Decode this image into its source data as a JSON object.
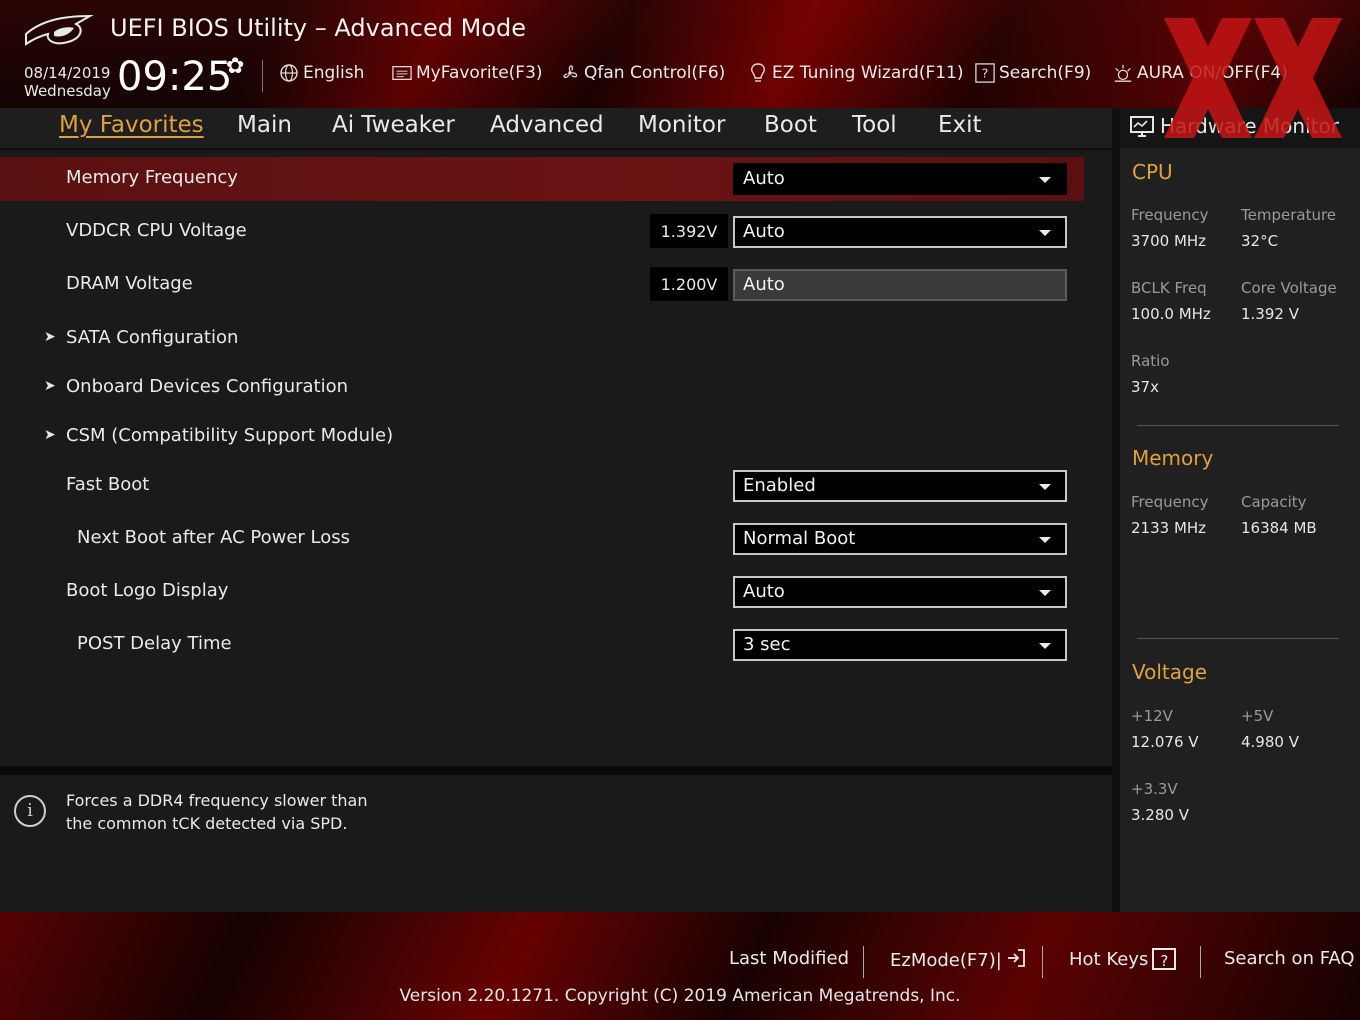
{
  "header": {
    "title": "UEFI BIOS Utility – Advanced Mode",
    "date": "08/14/2019",
    "weekday": "Wednesday",
    "time": "09:25",
    "tools": {
      "language": "English",
      "my_favorite": "MyFavorite(F3)",
      "qfan": "Qfan Control(F6)",
      "ez_tuning": "EZ Tuning Wizard(F11)",
      "search": "Search(F9)",
      "aura": "AURA ON/OFF(F4)"
    }
  },
  "tabs": [
    {
      "label": "My Favorites",
      "active": true
    },
    {
      "label": "Main"
    },
    {
      "label": "Ai Tweaker"
    },
    {
      "label": "Advanced"
    },
    {
      "label": "Monitor"
    },
    {
      "label": "Boot"
    },
    {
      "label": "Tool"
    },
    {
      "label": "Exit"
    }
  ],
  "settings": {
    "memory_frequency": {
      "label": "Memory Frequency",
      "value": "Auto"
    },
    "vddcr_cpu_voltage": {
      "label": "VDDCR CPU Voltage",
      "reading": "1.392V",
      "value": "Auto"
    },
    "dram_voltage": {
      "label": "DRAM Voltage",
      "reading": "1.200V",
      "value": "Auto"
    },
    "sata_config": {
      "label": "SATA Configuration"
    },
    "onboard_devices": {
      "label": "Onboard Devices Configuration"
    },
    "csm": {
      "label": "CSM (Compatibility Support Module)"
    },
    "fast_boot": {
      "label": "Fast Boot",
      "value": "Enabled"
    },
    "next_boot_ac": {
      "label": "Next Boot after AC Power Loss",
      "value": "Normal Boot"
    },
    "boot_logo": {
      "label": "Boot Logo Display",
      "value": "Auto"
    },
    "post_delay": {
      "label": "POST Delay Time",
      "value": "3 sec"
    }
  },
  "help": {
    "line1": "Forces a DDR4 frequency slower than",
    "line2": "the common tCK detected via SPD."
  },
  "hardware_monitor": {
    "title": "Hardware Monitor",
    "cpu": {
      "heading": "CPU",
      "frequency_label": "Frequency",
      "frequency": "3700 MHz",
      "temperature_label": "Temperature",
      "temperature": "32°C",
      "bclk_label": "BCLK Freq",
      "bclk": "100.0 MHz",
      "core_voltage_label": "Core Voltage",
      "core_voltage": "1.392 V",
      "ratio_label": "Ratio",
      "ratio": "37x"
    },
    "memory": {
      "heading": "Memory",
      "frequency_label": "Frequency",
      "frequency": "2133 MHz",
      "capacity_label": "Capacity",
      "capacity": "16384 MB"
    },
    "voltage": {
      "heading": "Voltage",
      "v12_label": "+12V",
      "v12": "12.076 V",
      "v5_label": "+5V",
      "v5": "4.980 V",
      "v33_label": "+3.3V",
      "v33": "3.280 V"
    }
  },
  "footer": {
    "last_modified": "Last Modified",
    "ezmode": "EzMode(F7)|",
    "hot_keys": "Hot Keys",
    "hot_keys_glyph": "?",
    "search_faq": "Search on FAQ",
    "version": "Version 2.20.1271. Copyright (C) 2019 American Megatrends, Inc."
  },
  "colors": {
    "accent": "#e0a040",
    "selected_row": "#6a1414",
    "header_red": "#8a0c0c"
  }
}
